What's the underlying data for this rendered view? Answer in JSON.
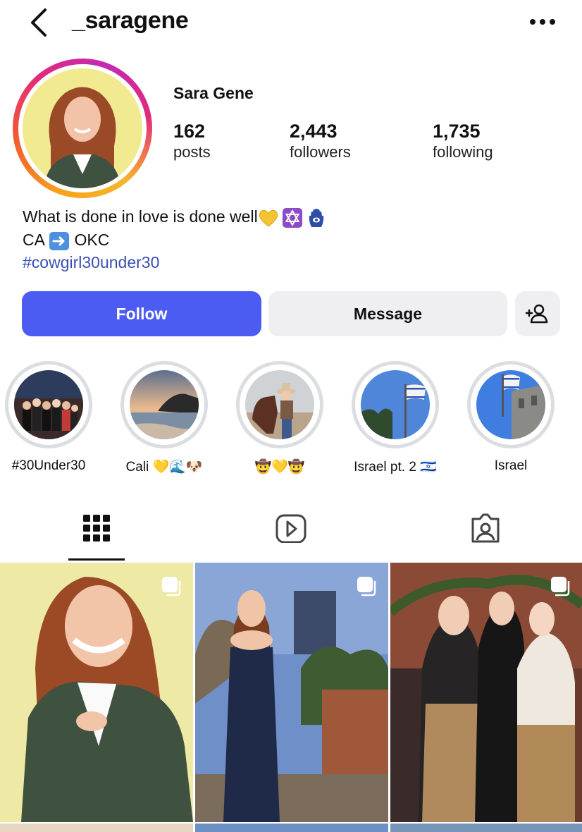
{
  "header": {
    "username": "_saragene"
  },
  "profile": {
    "full_name": "Sara Gene",
    "stats": [
      {
        "value": "162",
        "label": "posts"
      },
      {
        "value": "2,443",
        "label": "followers"
      },
      {
        "value": "1,735",
        "label": "following"
      }
    ],
    "bio": {
      "line1": "What is done in love is done well",
      "line1_emojis": [
        "yellow-heart",
        "star-of-david",
        "hamsa"
      ],
      "line2_start": "CA",
      "line2_end": "OKC",
      "hashtag": "#cowgirl30under30"
    }
  },
  "actions": {
    "follow": "Follow",
    "message": "Message",
    "add_user_icon": "add-person-icon"
  },
  "highlights": [
    {
      "label": "#30Under30"
    },
    {
      "label": "Cali 💛🌊🐶"
    },
    {
      "label": "🤠💛🤠"
    },
    {
      "label": "Israel pt. 2 🇮🇱"
    },
    {
      "label": "Israel"
    }
  ],
  "tabs": [
    {
      "icon": "grid-icon",
      "active": true
    },
    {
      "icon": "reels-icon",
      "active": false
    },
    {
      "icon": "tagged-icon",
      "active": false
    }
  ],
  "colors": {
    "accent": "#4c5cf3",
    "hashtag": "#3a4fb3",
    "button_gray": "#efeff1"
  }
}
